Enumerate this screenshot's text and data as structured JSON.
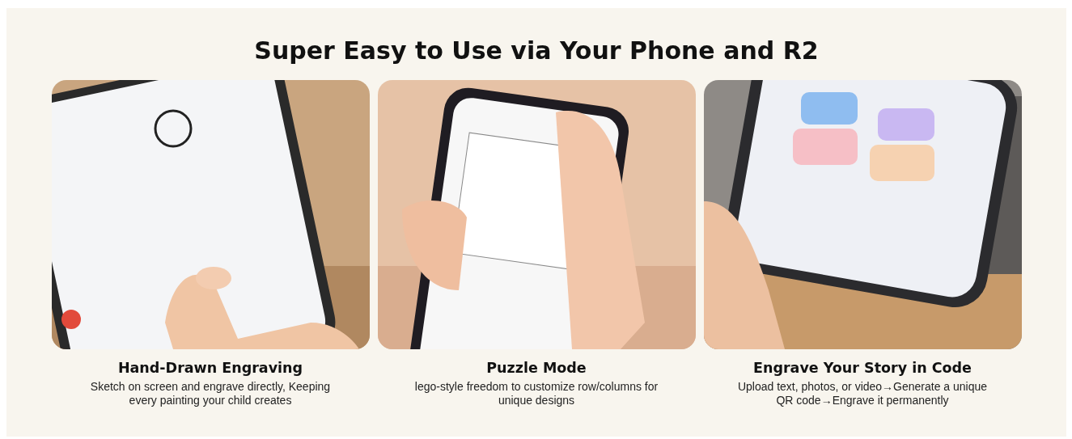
{
  "heading": "Super Easy to Use via Your Phone and R2",
  "features": [
    {
      "kind": "picture",
      "title": "Hand-Drawn Engraving",
      "description": "Sketch on screen and engrave directly, Keeping every painting your child creates"
    },
    {
      "kind": "picture",
      "title": "Puzzle Mode",
      "description": "lego-style freedom to customize row/columns for unique designs"
    },
    {
      "kind": "picture",
      "title": "Engrave Your Story in Code",
      "description": "Upload text, photos, or video→Generate a unique QR code→Engrave it permanently"
    }
  ]
}
